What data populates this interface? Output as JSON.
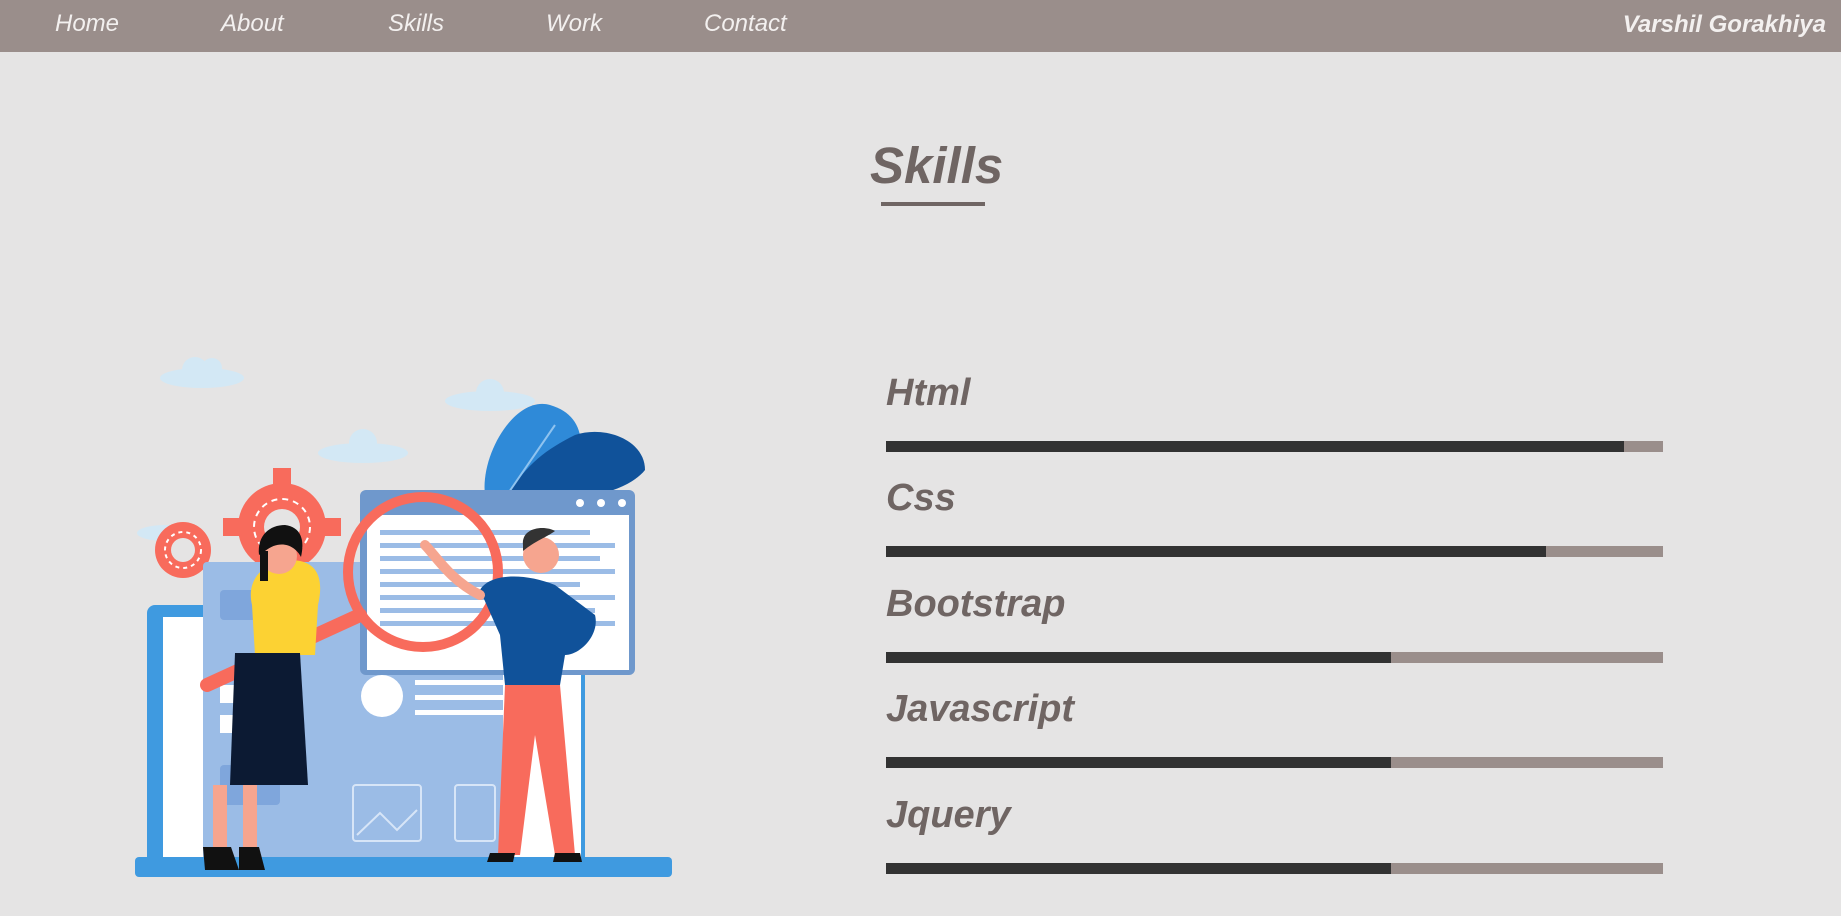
{
  "nav": {
    "items": [
      {
        "label": "Home"
      },
      {
        "label": "About"
      },
      {
        "label": "Skills"
      },
      {
        "label": "Work"
      },
      {
        "label": "Contact"
      }
    ],
    "brand": "Varshil Gorakhiya"
  },
  "skills_section": {
    "title": "Skills",
    "items": [
      {
        "name": "Html",
        "level": 0.95
      },
      {
        "name": "Css",
        "level": 0.85
      },
      {
        "name": "Bootstrap",
        "level": 0.65
      },
      {
        "name": "Javascript",
        "level": 0.65
      },
      {
        "name": "Jquery",
        "level": 0.65
      }
    ]
  },
  "colors": {
    "navbar": "#9a8e8b",
    "background": "#e5e4e4",
    "text_heading": "#6f6563",
    "bar_fill": "#323232",
    "bar_track": "#9a8e8b",
    "accent_coral": "#f86b5c",
    "accent_blue": "#1e5a9e"
  }
}
